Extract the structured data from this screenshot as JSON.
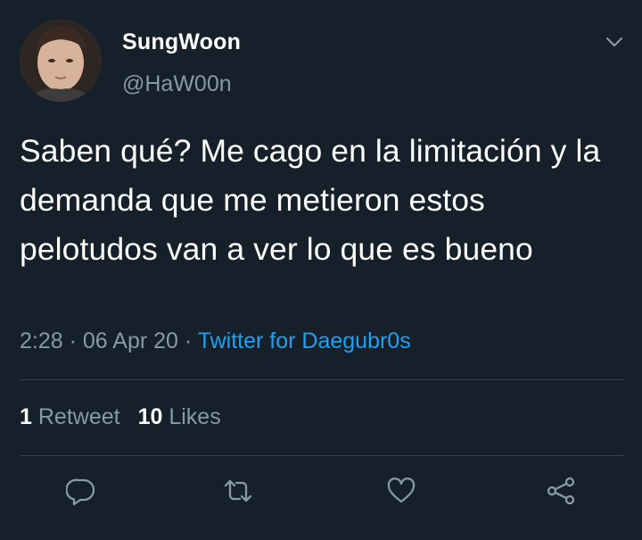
{
  "user": {
    "display_name": "SungWoon",
    "handle": "@HaW00n"
  },
  "tweet": {
    "text": "Saben qué? Me cago en la limitación y la demanda que me metieron estos pelotudos van a ver lo que es bueno",
    "time": "2:28",
    "separator": "·",
    "date": "06 Apr 20",
    "source": "Twitter for Daegubr0s"
  },
  "stats": {
    "retweets_count": "1",
    "retweets_label": "Retweet",
    "likes_count": "10",
    "likes_label": "Likes"
  },
  "actions": [
    {
      "icon": "reply-icon"
    },
    {
      "icon": "retweet-icon"
    },
    {
      "icon": "like-icon"
    },
    {
      "icon": "share-icon"
    }
  ],
  "colors": {
    "background": "#15202b",
    "text": "#ffffff",
    "secondary_text": "#8899a6",
    "link": "#1da1f2",
    "divider": "#38444d"
  }
}
